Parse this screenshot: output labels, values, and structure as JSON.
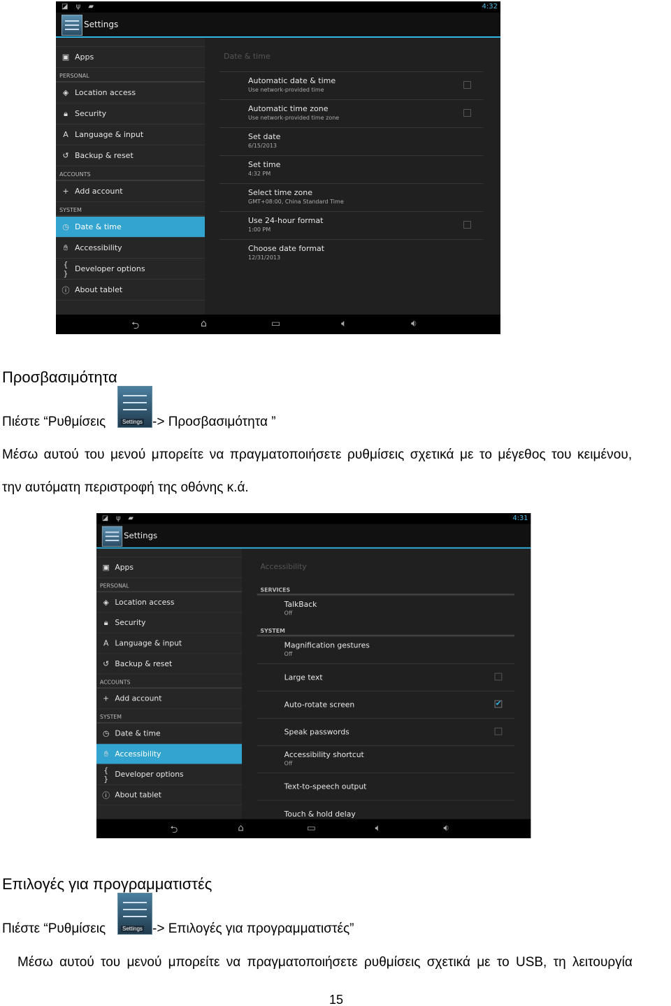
{
  "screens": [
    {
      "time": "4:32",
      "app_title": "Settings",
      "panel_title": "Date & time",
      "sidebar": [
        {
          "type": "partial"
        },
        {
          "type": "item",
          "icon": "apps-icon",
          "glyph": "▣",
          "label": "Apps"
        },
        {
          "type": "header",
          "label": "PERSONAL"
        },
        {
          "type": "item",
          "icon": "location-icon",
          "glyph": "◈",
          "label": "Location access"
        },
        {
          "type": "item",
          "icon": "lock-icon",
          "glyph": "🔒︎",
          "label": "Security"
        },
        {
          "type": "item",
          "icon": "language-icon",
          "glyph": "A",
          "label": "Language & input"
        },
        {
          "type": "item",
          "icon": "backup-icon",
          "glyph": "↺",
          "label": "Backup & reset"
        },
        {
          "type": "header",
          "label": "ACCOUNTS"
        },
        {
          "type": "item",
          "icon": "plus-icon",
          "glyph": "+",
          "label": "Add account"
        },
        {
          "type": "header",
          "label": "SYSTEM"
        },
        {
          "type": "item",
          "icon": "clock-icon",
          "glyph": "◷",
          "label": "Date & time",
          "selected": true
        },
        {
          "type": "item",
          "icon": "hand-icon",
          "glyph": "✋︎",
          "label": "Accessibility"
        },
        {
          "type": "item",
          "icon": "braces-icon",
          "glyph": "{ }",
          "label": "Developer options"
        },
        {
          "type": "item",
          "icon": "info-icon",
          "glyph": "ⓘ",
          "label": "About tablet"
        }
      ],
      "items": [
        {
          "type": "item",
          "title": "Automatic date & time",
          "sub": "Use network-provided time",
          "checkbox": false
        },
        {
          "type": "item",
          "title": "Automatic time zone",
          "sub": "Use network-provided time zone",
          "checkbox": false
        },
        {
          "type": "item",
          "title": "Set date",
          "sub": "6/15/2013"
        },
        {
          "type": "item",
          "title": "Set time",
          "sub": "4:32 PM"
        },
        {
          "type": "item",
          "title": "Select time zone",
          "sub": "GMT+08:00, China Standard Time"
        },
        {
          "type": "item",
          "title": "Use 24-hour format",
          "sub": "1:00 PM",
          "checkbox": false
        },
        {
          "type": "item",
          "title": "Choose date format",
          "sub": "12/31/2013"
        }
      ]
    },
    {
      "time": "4:31",
      "app_title": "Settings",
      "panel_title": "Accessibility",
      "sidebar": [
        {
          "type": "partial"
        },
        {
          "type": "item",
          "icon": "apps-icon",
          "glyph": "▣",
          "label": "Apps"
        },
        {
          "type": "header",
          "label": "PERSONAL"
        },
        {
          "type": "item",
          "icon": "location-icon",
          "glyph": "◈",
          "label": "Location access"
        },
        {
          "type": "item",
          "icon": "lock-icon",
          "glyph": "🔒︎",
          "label": "Security"
        },
        {
          "type": "item",
          "icon": "language-icon",
          "glyph": "A",
          "label": "Language & input"
        },
        {
          "type": "item",
          "icon": "backup-icon",
          "glyph": "↺",
          "label": "Backup & reset"
        },
        {
          "type": "header",
          "label": "ACCOUNTS"
        },
        {
          "type": "item",
          "icon": "plus-icon",
          "glyph": "+",
          "label": "Add account"
        },
        {
          "type": "header",
          "label": "SYSTEM"
        },
        {
          "type": "item",
          "icon": "clock-icon",
          "glyph": "◷",
          "label": "Date & time"
        },
        {
          "type": "item",
          "icon": "hand-icon",
          "glyph": "✋︎",
          "label": "Accessibility",
          "selected": true
        },
        {
          "type": "item",
          "icon": "braces-icon",
          "glyph": "{ }",
          "label": "Developer options"
        },
        {
          "type": "item",
          "icon": "info-icon",
          "glyph": "ⓘ",
          "label": "About tablet"
        }
      ],
      "items": [
        {
          "type": "section",
          "title": "SERVICES"
        },
        {
          "type": "item",
          "title": "TalkBack",
          "sub": "Off"
        },
        {
          "type": "section",
          "title": "SYSTEM"
        },
        {
          "type": "item",
          "title": "Magnification gestures",
          "sub": "Off"
        },
        {
          "type": "item",
          "title": "Large text",
          "checkbox": false
        },
        {
          "type": "item",
          "title": "Auto-rotate screen",
          "checkbox": true
        },
        {
          "type": "item",
          "title": "Speak passwords",
          "checkbox": false
        },
        {
          "type": "item",
          "title": "Accessibility shortcut",
          "sub": "Off"
        },
        {
          "type": "item",
          "title": "Text-to-speech output"
        },
        {
          "type": "item",
          "title": "Touch & hold delay"
        }
      ]
    }
  ],
  "doc": {
    "heading1": "Προσβασιμότητα",
    "line1_a": "Πιέστε “Ρυθμίσεις ",
    "line1_b": "-> Προσβασιμότητα ”",
    "settings_icon_label": "Settings",
    "para1_l1": "Μέσω αυτού του μενού μπορείτε να πραγματοποιήσετε ρυθμίσεις σχετικά με το μέγεθος του κειμένου,",
    "para1_l2": "την αυτόματη περιστροφή της οθόνης κ.ά.",
    "heading2": "Επιλογές για προγραμματιστές",
    "line2_a": "Πιέστε “Ρυθμίσεις ",
    "line2_b": "-> Επιλογές για προγραμματιστές”",
    "para2_l1": "Μέσω αυτού του μενού μπορείτε να πραγματοποιήσετε ρυθμίσεις σχετικά με το USB, τη λειτουργία",
    "page_number": "15"
  },
  "colors": {
    "accent": "#33b5e5",
    "selected": "#33a4cf"
  }
}
